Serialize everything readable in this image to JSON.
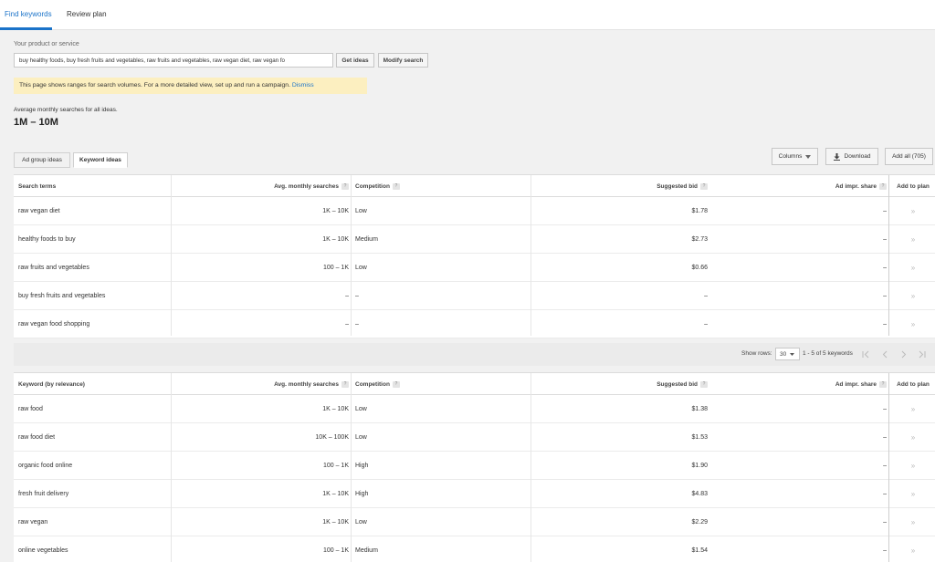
{
  "top_tabs": [
    "Find keywords",
    "Review plan"
  ],
  "search": {
    "label": "Your product or service",
    "value": "buy healthy foods, buy fresh fruits and vegetables, raw fruits and vegetables, raw vegan diet, raw vegan fo",
    "get_ideas": "Get ideas",
    "modify_search": "Modify search"
  },
  "notice": {
    "text": "This page shows ranges for search volumes. For a more detailed view, set up and run a campaign.",
    "dismiss": "Dismiss"
  },
  "average": {
    "label": "Average monthly searches for all ideas.",
    "value": "1M – 10M"
  },
  "sub_tabs": [
    "Ad group ideas",
    "Keyword ideas"
  ],
  "toolbar": {
    "columns": "Columns",
    "download": "Download",
    "add_all": "Add all (705)"
  },
  "search_terms_table": {
    "headers": [
      "Search terms",
      "Avg. monthly searches",
      "Competition",
      "Suggested bid",
      "Ad impr. share",
      "Add to plan"
    ],
    "rows": [
      [
        "raw vegan diet",
        "1K – 10K",
        "Low",
        "$1.78",
        "–"
      ],
      [
        "healthy foods to buy",
        "1K – 10K",
        "Medium",
        "$2.73",
        "–"
      ],
      [
        "raw fruits and vegetables",
        "100 – 1K",
        "Low",
        "$0.66",
        "–"
      ],
      [
        "buy fresh fruits and vegetables",
        "–",
        "–",
        "–",
        "–"
      ],
      [
        "raw vegan food shopping",
        "–",
        "–",
        "–",
        "–"
      ]
    ]
  },
  "pagination": {
    "show_rows_label": "Show rows:",
    "rows_value": "30",
    "range": "1 - 5 of 5 keywords"
  },
  "keyword_table": {
    "headers": [
      "Keyword (by relevance)",
      "Avg. monthly searches",
      "Competition",
      "Suggested bid",
      "Ad impr. share",
      "Add to plan"
    ],
    "rows": [
      [
        "raw food",
        "1K – 10K",
        "Low",
        "$1.38",
        "–"
      ],
      [
        "raw food diet",
        "10K – 100K",
        "Low",
        "$1.53",
        "–"
      ],
      [
        "organic food online",
        "100 – 1K",
        "High",
        "$1.90",
        "–"
      ],
      [
        "fresh fruit delivery",
        "1K – 10K",
        "High",
        "$4.83",
        "–"
      ],
      [
        "raw vegan",
        "1K – 10K",
        "Low",
        "$2.29",
        "–"
      ],
      [
        "online vegetables",
        "100 – 1K",
        "Medium",
        "$1.54",
        "–"
      ]
    ]
  },
  "help_mark": "?",
  "add_glyph": "»",
  "colors": {
    "accent": "#1a73c9",
    "notice_bg": "#fcefc0",
    "page_bg": "#f1f1f1"
  }
}
